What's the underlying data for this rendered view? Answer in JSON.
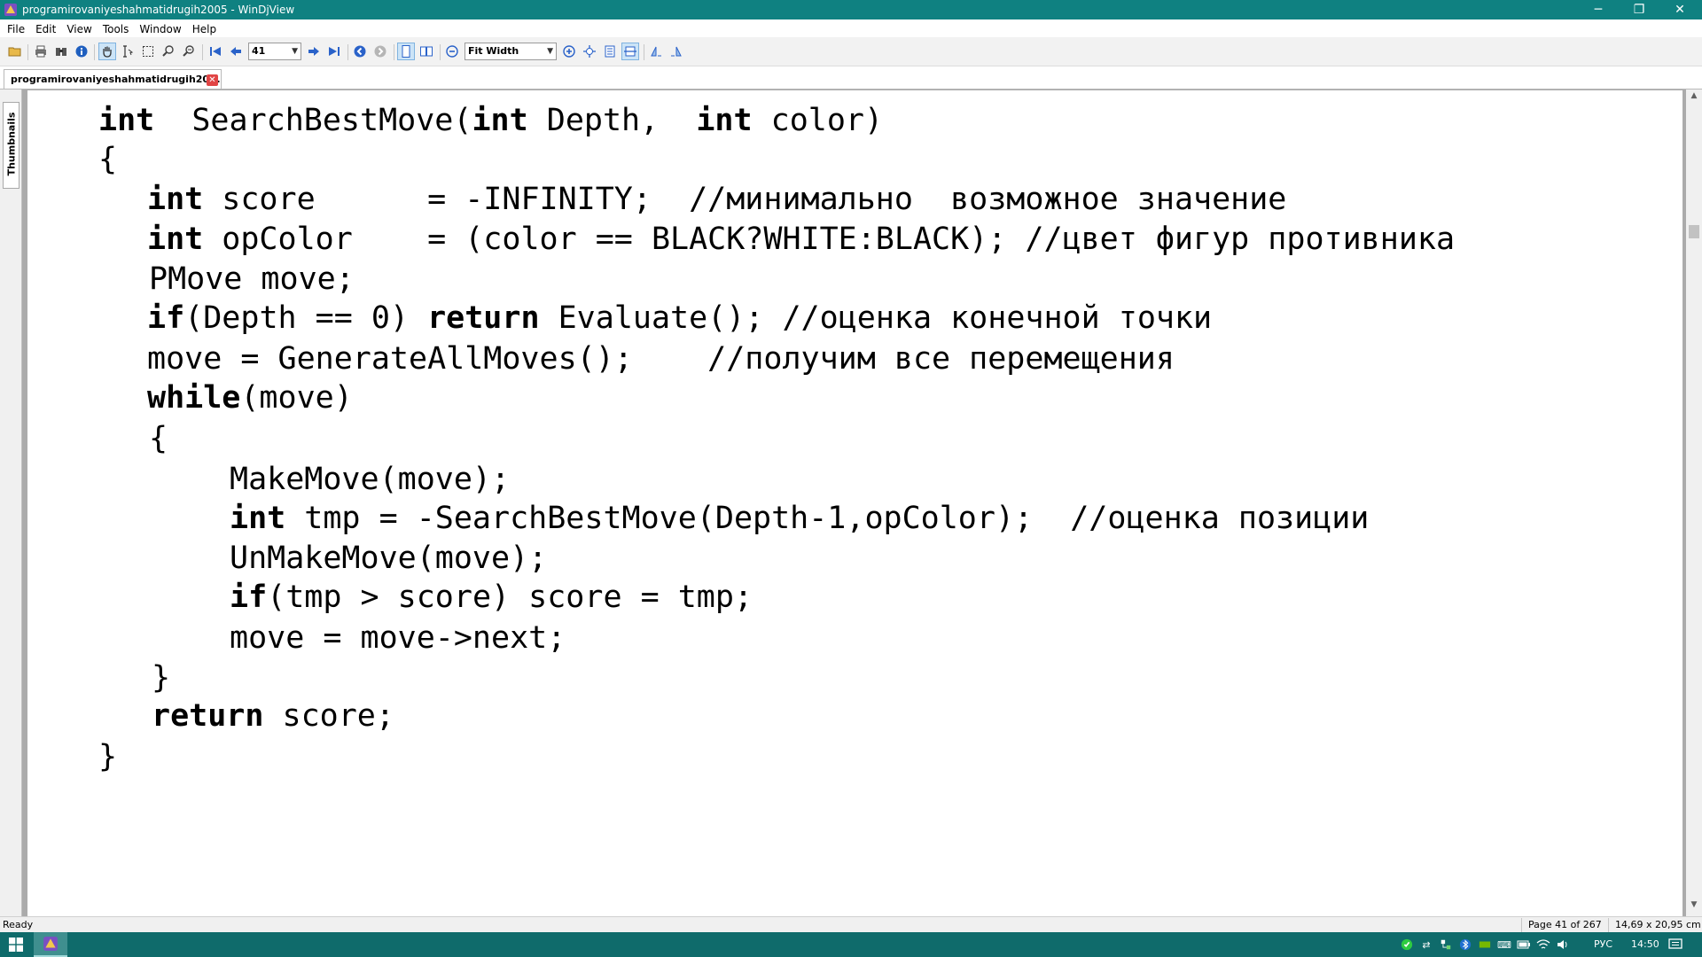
{
  "window": {
    "title": "programirovaniyeshahmatidrugih2005 - WinDjView",
    "minimize_glyph": "─",
    "maximize_glyph": "❐",
    "close_glyph": "✕"
  },
  "menu": [
    "File",
    "Edit",
    "View",
    "Tools",
    "Window",
    "Help"
  ],
  "toolbar": {
    "page_number": "41",
    "zoom": "Fit Width",
    "icons": [
      "open-icon",
      "print-icon",
      "find-icon",
      "info-icon",
      "hand-tool-icon",
      "select-text-icon",
      "select-area-icon",
      "zoom-in-tool-icon",
      "zoom-out-tool-icon",
      "first-page-icon",
      "previous-page-icon",
      "next-page-icon",
      "last-page-icon",
      "back-icon",
      "forward-icon",
      "single-page-icon",
      "facing-pages-icon",
      "zoom-out-icon",
      "zoom-in-icon",
      "fit-page-icon",
      "actual-size-icon",
      "fit-width-icon",
      "rotate-left-icon",
      "rotate-right-icon"
    ]
  },
  "tab": {
    "label": "programirovaniyeshahmatidrugih20...",
    "close_glyph": "✕"
  },
  "sidebar": {
    "thumbnails_label": "Thumbnails"
  },
  "document": {
    "lines": [
      [
        {
          "t": "int",
          "b": true
        },
        {
          "t": "  SearchBestMove("
        },
        {
          "t": "int",
          "b": true
        },
        {
          "t": " Depth,  "
        },
        {
          "t": "int",
          "b": true
        },
        {
          "t": " color)"
        }
      ],
      [
        {
          "t": "{"
        }
      ],
      [
        {
          "t": "int",
          "b": true
        },
        {
          "t": " score      = -INFINITY;  //минимально  возможное значение"
        }
      ],
      [
        {
          "t": "int",
          "b": true
        },
        {
          "t": " opColor    = (color == BLACK?WHITE:BLACK); //цвет фигур противника"
        }
      ],
      [
        {
          "t": "PMove move;"
        }
      ],
      [
        {
          "t": "if",
          "b": true
        },
        {
          "t": "(Depth == 0) "
        },
        {
          "t": "return",
          "b": true
        },
        {
          "t": " Evaluate(); //оценка конечной точки"
        }
      ],
      [
        {
          "t": "move = GenerateAllMoves();    //получим все перемещения"
        }
      ],
      [
        {
          "t": "while",
          "b": true
        },
        {
          "t": "(move)"
        }
      ],
      [
        {
          "t": "{"
        }
      ],
      [
        {
          "t": "MakeMove(move);"
        }
      ],
      [
        {
          "t": "int",
          "b": true
        },
        {
          "t": " tmp = -SearchBestMove(Depth-1,opColor);  //оценка позиции"
        }
      ],
      [
        {
          "t": "UnMakeMove(move);"
        }
      ],
      [
        {
          "t": "if",
          "b": true
        },
        {
          "t": "(tmp > score) score = tmp;"
        }
      ],
      [
        {
          "t": "move = move->next;"
        }
      ],
      [
        {
          "t": "}"
        }
      ],
      [
        {
          "t": "return",
          "b": true
        },
        {
          "t": " score;"
        }
      ],
      [
        {
          "t": "}"
        }
      ]
    ]
  },
  "status": {
    "ready": "Ready",
    "page": "Page 41 of 267",
    "size": "14,69 x 20,95 cm"
  },
  "taskbar": {
    "language": "РУС",
    "clock": "14:50"
  },
  "colors": {
    "titlebar": "#0f8181",
    "taskbar": "#0f6b6b",
    "tab_close": "#e14545",
    "accent": "#cce4f7"
  }
}
